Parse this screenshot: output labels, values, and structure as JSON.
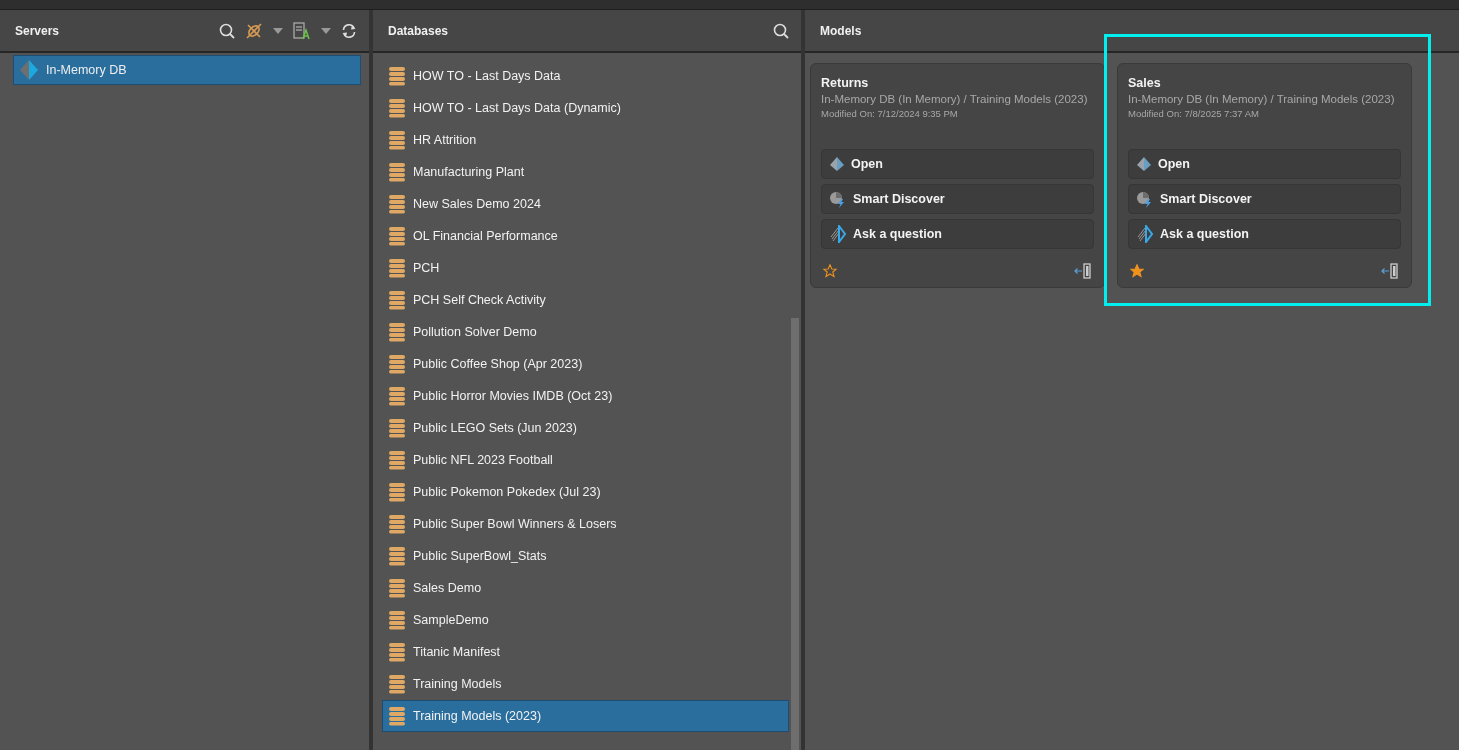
{
  "servers": {
    "title": "Servers",
    "items": [
      {
        "label": "In-Memory DB",
        "selected": true
      }
    ]
  },
  "databases": {
    "title": "Databases",
    "items": [
      {
        "label": "HOW TO - Last Days Data",
        "selected": false
      },
      {
        "label": "HOW TO - Last Days Data (Dynamic)",
        "selected": false
      },
      {
        "label": "HR Attrition",
        "selected": false
      },
      {
        "label": "Manufacturing Plant",
        "selected": false
      },
      {
        "label": "New Sales Demo 2024",
        "selected": false
      },
      {
        "label": "OL Financial Performance",
        "selected": false
      },
      {
        "label": "PCH",
        "selected": false
      },
      {
        "label": "PCH Self Check Activity",
        "selected": false
      },
      {
        "label": "Pollution Solver Demo",
        "selected": false
      },
      {
        "label": "Public Coffee Shop (Apr 2023)",
        "selected": false
      },
      {
        "label": "Public Horror Movies IMDB (Oct 23)",
        "selected": false
      },
      {
        "label": "Public LEGO Sets (Jun 2023)",
        "selected": false
      },
      {
        "label": "Public NFL 2023 Football",
        "selected": false
      },
      {
        "label": "Public Pokemon Pokedex (Jul 23)",
        "selected": false
      },
      {
        "label": "Public Super Bowl Winners & Losers",
        "selected": false
      },
      {
        "label": "Public SuperBowl_Stats",
        "selected": false
      },
      {
        "label": "Sales Demo",
        "selected": false
      },
      {
        "label": "SampleDemo",
        "selected": false
      },
      {
        "label": "Titanic Manifest",
        "selected": false
      },
      {
        "label": "Training Models",
        "selected": false
      },
      {
        "label": "Training Models (2023)",
        "selected": true
      }
    ]
  },
  "models": {
    "title": "Models",
    "cards": [
      {
        "name": "Returns",
        "path": "In-Memory DB (In Memory) / Training Models (2023)",
        "modified": "Modified On: 7/12/2024 9:35 PM",
        "favorite": false,
        "highlighted": false,
        "actions": [
          {
            "kind": "open",
            "label": "Open"
          },
          {
            "kind": "discover",
            "label": "Smart Discover"
          },
          {
            "kind": "ask",
            "label": "Ask a question"
          }
        ]
      },
      {
        "name": "Sales",
        "path": "In-Memory DB (In Memory) / Training Models (2023)",
        "modified": "Modified On: 7/8/2025 7:37 AM",
        "favorite": true,
        "highlighted": true,
        "actions": [
          {
            "kind": "open",
            "label": "Open"
          },
          {
            "kind": "discover",
            "label": "Smart Discover"
          },
          {
            "kind": "ask",
            "label": "Ask a question"
          }
        ]
      }
    ]
  }
}
